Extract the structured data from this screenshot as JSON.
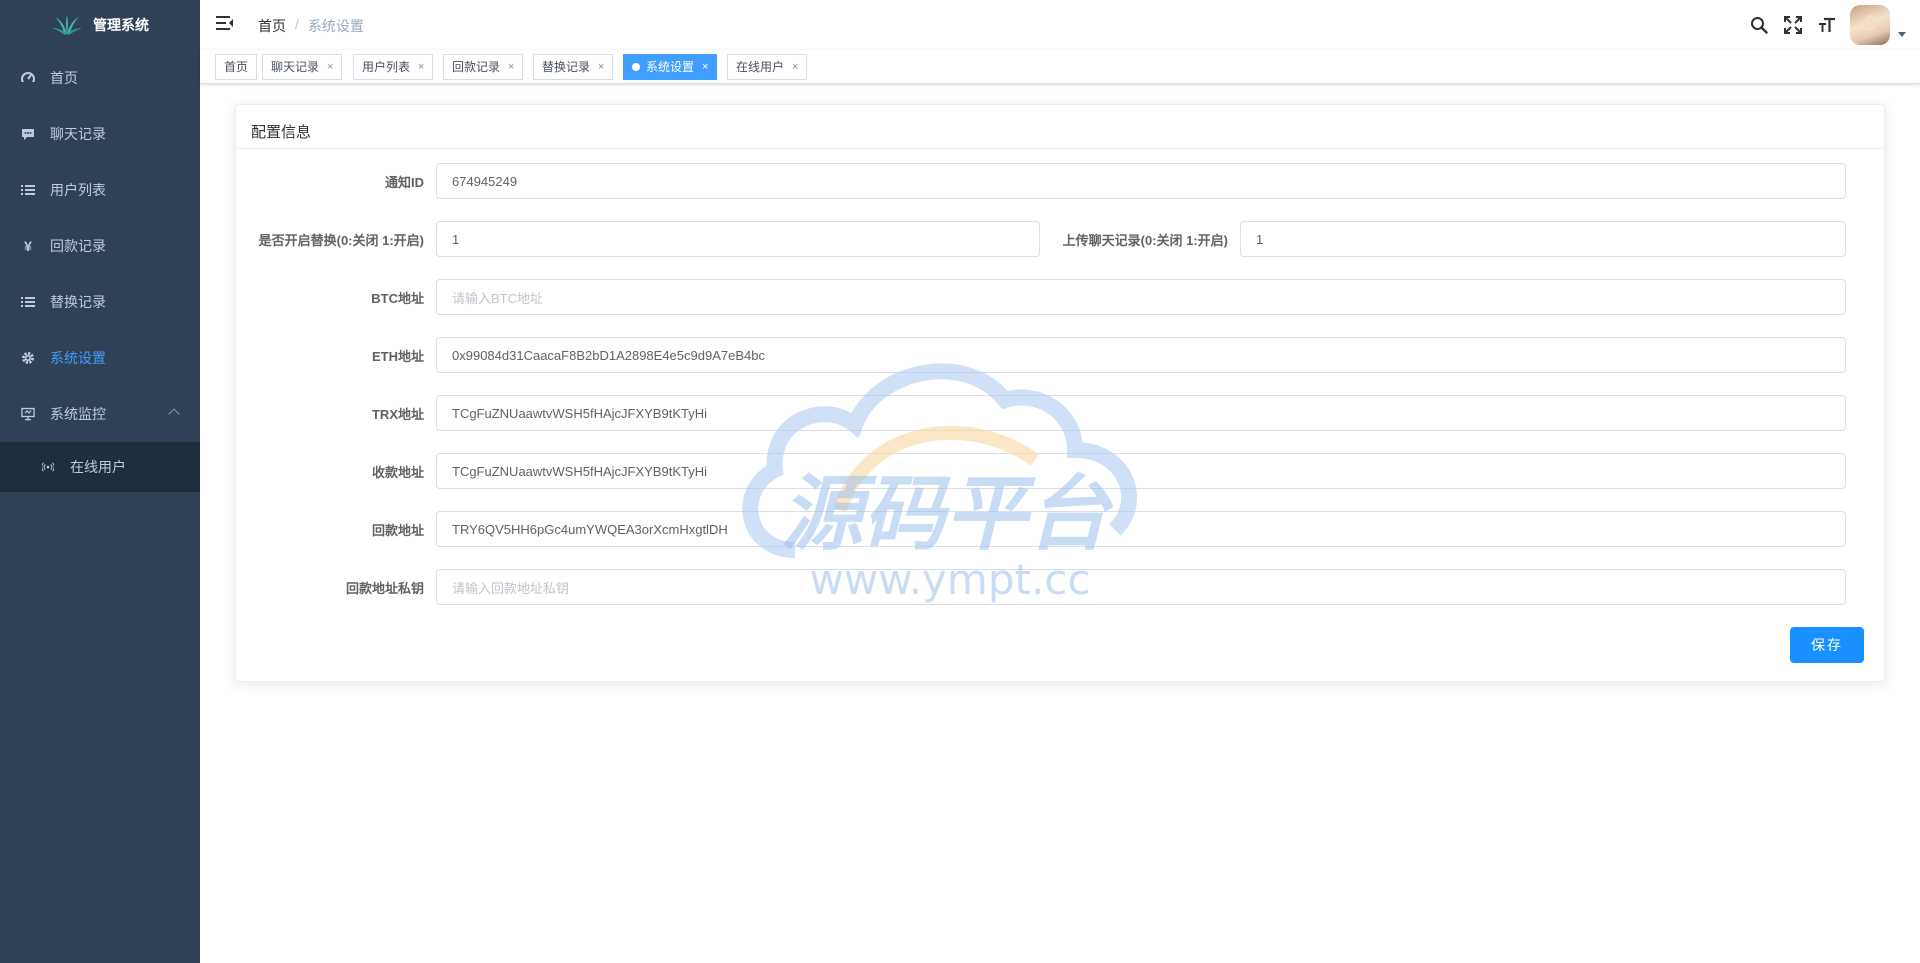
{
  "app": {
    "title": "管理系统"
  },
  "sidebar": {
    "items": [
      {
        "label": "首页",
        "icon": "dashboard-icon"
      },
      {
        "label": "聊天记录",
        "icon": "message-icon"
      },
      {
        "label": "用户列表",
        "icon": "list-icon"
      },
      {
        "label": "回款记录",
        "icon": "yen-icon"
      },
      {
        "label": "替换记录",
        "icon": "list-icon"
      },
      {
        "label": "系统设置",
        "icon": "gear-icon",
        "active": true
      },
      {
        "label": "系统监控",
        "icon": "monitor-icon",
        "expanded": true
      }
    ],
    "submenu": [
      {
        "label": "在线用户",
        "icon": "online-icon"
      }
    ]
  },
  "breadcrumb": {
    "home": "首页",
    "separator": "/",
    "current": "系统设置"
  },
  "tags": [
    {
      "label": "首页",
      "closable": false
    },
    {
      "label": "聊天记录",
      "closable": true
    },
    {
      "label": "用户列表",
      "closable": true
    },
    {
      "label": "回款记录",
      "closable": true
    },
    {
      "label": "替换记录",
      "closable": true
    },
    {
      "label": "系统设置",
      "closable": true,
      "active": true
    },
    {
      "label": "在线用户",
      "closable": true
    }
  ],
  "tag_close": "×",
  "card": {
    "title": "配置信息"
  },
  "form": {
    "notify_id": {
      "label": "通知ID",
      "value": "674945249",
      "placeholder": ""
    },
    "replace_enabled": {
      "label": "是否开启替换(0:关闭 1:开启)",
      "value": "1"
    },
    "upload_chat": {
      "label": "上传聊天记录(0:关闭 1:开启)",
      "value": "1"
    },
    "btc": {
      "label": "BTC地址",
      "value": "",
      "placeholder": "请输入BTC地址"
    },
    "eth": {
      "label": "ETH地址",
      "value": "0x99084d31CaacaF8B2bD1A2898E4e5c9d9A7eB4bc"
    },
    "trx": {
      "label": "TRX地址",
      "value": "TCgFuZNUaawtvWSH5fHAjcJFXYB9tKTyHi"
    },
    "receive": {
      "label": "收款地址",
      "value": "TCgFuZNUaawtvWSH5fHAjcJFXYB9tKTyHi"
    },
    "refund": {
      "label": "回款地址",
      "value": "TRY6QV5HH6pGc4umYWQEA3orXcmHxgtlDH"
    },
    "refund_key": {
      "label": "回款地址私钥",
      "value": "",
      "placeholder": "请输入回款地址私钥"
    }
  },
  "save_button": {
    "label": "保存"
  },
  "watermark": {
    "text": "源码平台",
    "url": "www.ympt.cc"
  },
  "colors": {
    "sidebar": "#304156",
    "sidebar_sub": "#1f2d3d",
    "accent": "#409eff",
    "button": "#1890ff"
  }
}
